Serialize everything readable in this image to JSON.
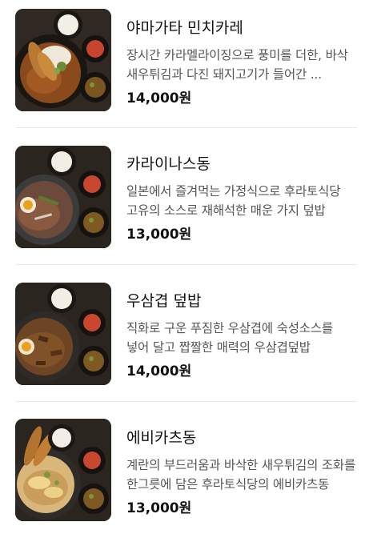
{
  "menu": {
    "items": [
      {
        "title": "야마가타 민치카레",
        "description": "장시간 카라멜라이징으로 풍미를 더한, 바삭 새우튀김과 다진 돼지고기가 들어간 ...",
        "price": "14,000원",
        "image_icon": "curry-set-photo"
      },
      {
        "title": "카라이나스동",
        "description": "일본에서 즐겨먹는 가정식으로 후라토식당 고유의 소스로 재해석한 매운 가지 덮밥",
        "price": "13,000원",
        "image_icon": "eggplant-rice-bowl-photo"
      },
      {
        "title": "우삼겹 덮밥",
        "description": "직화로 구운 푸짐한 우삼겹에 숙성소스를 넣어 달고 짭짤한 매력의 우삼겹덮밥",
        "price": "14,000원",
        "image_icon": "beef-brisket-rice-bowl-photo"
      },
      {
        "title": "에비카츠동",
        "description": "계란의 부드러움과 바삭한 새우튀김의 조화를 한그릇에 담은 후라토식당의 에비카츠동",
        "price": "13,000원",
        "image_icon": "shrimp-katsu-rice-bowl-photo"
      }
    ]
  }
}
